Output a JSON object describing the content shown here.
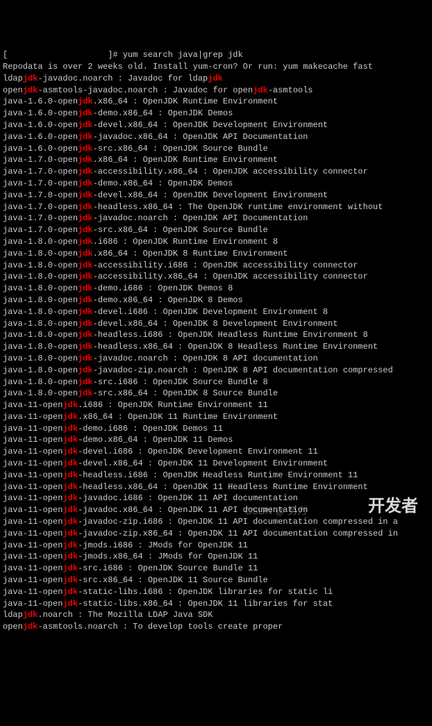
{
  "prompt_prefix": "[",
  "prompt_suffix": "]# ",
  "command": "yum search java|grep jdk",
  "repo_msg": "Repodata is over 2 weeks old. Install yum-cron? Or run: yum makecache fast",
  "lines": [
    {
      "pre": "ldap",
      "hl": "jdk",
      "mid": "-javadoc.noarch : Javadoc for ldap",
      "hl2": "jdk",
      "post": ""
    },
    {
      "pre": "open",
      "hl": "jdk",
      "mid": "-asmtools-javadoc.noarch : Javadoc for open",
      "hl2": "jdk",
      "post": "-asmtools"
    },
    {
      "pre": "java-1.6.0-open",
      "hl": "jdk",
      "mid": ".x86_64 : OpenJDK Runtime Environment",
      "hl2": "",
      "post": ""
    },
    {
      "pre": "java-1.6.0-open",
      "hl": "jdk",
      "mid": "-demo.x86_64 : OpenJDK Demos",
      "hl2": "",
      "post": ""
    },
    {
      "pre": "java-1.6.0-open",
      "hl": "jdk",
      "mid": "-devel.x86_64 : OpenJDK Development Environment",
      "hl2": "",
      "post": ""
    },
    {
      "pre": "java-1.6.0-open",
      "hl": "jdk",
      "mid": "-javadoc.x86_64 : OpenJDK API Documentation",
      "hl2": "",
      "post": ""
    },
    {
      "pre": "java-1.6.0-open",
      "hl": "jdk",
      "mid": "-src.x86_64 : OpenJDK Source Bundle",
      "hl2": "",
      "post": ""
    },
    {
      "pre": "java-1.7.0-open",
      "hl": "jdk",
      "mid": ".x86_64 : OpenJDK Runtime Environment",
      "hl2": "",
      "post": ""
    },
    {
      "pre": "java-1.7.0-open",
      "hl": "jdk",
      "mid": "-accessibility.x86_64 : OpenJDK accessibility connector",
      "hl2": "",
      "post": ""
    },
    {
      "pre": "java-1.7.0-open",
      "hl": "jdk",
      "mid": "-demo.x86_64 : OpenJDK Demos",
      "hl2": "",
      "post": ""
    },
    {
      "pre": "java-1.7.0-open",
      "hl": "jdk",
      "mid": "-devel.x86_64 : OpenJDK Development Environment",
      "hl2": "",
      "post": ""
    },
    {
      "pre": "java-1.7.0-open",
      "hl": "jdk",
      "mid": "-headless.x86_64 : The OpenJDK runtime environment without",
      "hl2": "",
      "post": ""
    },
    {
      "pre": "java-1.7.0-open",
      "hl": "jdk",
      "mid": "-javadoc.noarch : OpenJDK API Documentation",
      "hl2": "",
      "post": ""
    },
    {
      "pre": "java-1.7.0-open",
      "hl": "jdk",
      "mid": "-src.x86_64 : OpenJDK Source Bundle",
      "hl2": "",
      "post": ""
    },
    {
      "pre": "java-1.8.0-open",
      "hl": "jdk",
      "mid": ".i686 : OpenJDK Runtime Environment 8",
      "hl2": "",
      "post": ""
    },
    {
      "pre": "java-1.8.0-open",
      "hl": "jdk",
      "mid": ".x86_64 : OpenJDK 8 Runtime Environment",
      "hl2": "",
      "post": ""
    },
    {
      "pre": "java-1.8.0-open",
      "hl": "jdk",
      "mid": "-accessibility.i686 : OpenJDK accessibility connector",
      "hl2": "",
      "post": ""
    },
    {
      "pre": "java-1.8.0-open",
      "hl": "jdk",
      "mid": "-accessibility.x86_64 : OpenJDK accessibility connector",
      "hl2": "",
      "post": ""
    },
    {
      "pre": "java-1.8.0-open",
      "hl": "jdk",
      "mid": "-demo.i686 : OpenJDK Demos 8",
      "hl2": "",
      "post": ""
    },
    {
      "pre": "java-1.8.0-open",
      "hl": "jdk",
      "mid": "-demo.x86_64 : OpenJDK 8 Demos",
      "hl2": "",
      "post": ""
    },
    {
      "pre": "java-1.8.0-open",
      "hl": "jdk",
      "mid": "-devel.i686 : OpenJDK Development Environment 8",
      "hl2": "",
      "post": ""
    },
    {
      "pre": "java-1.8.0-open",
      "hl": "jdk",
      "mid": "-devel.x86_64 : OpenJDK 8 Development Environment",
      "hl2": "",
      "post": ""
    },
    {
      "pre": "java-1.8.0-open",
      "hl": "jdk",
      "mid": "-headless.i686 : OpenJDK Headless Runtime Environment 8",
      "hl2": "",
      "post": ""
    },
    {
      "pre": "java-1.8.0-open",
      "hl": "jdk",
      "mid": "-headless.x86_64 : OpenJDK 8 Headless Runtime Environment",
      "hl2": "",
      "post": ""
    },
    {
      "pre": "java-1.8.0-open",
      "hl": "jdk",
      "mid": "-javadoc.noarch : OpenJDK 8 API documentation",
      "hl2": "",
      "post": ""
    },
    {
      "pre": "java-1.8.0-open",
      "hl": "jdk",
      "mid": "-javadoc-zip.noarch : OpenJDK 8 API documentation compressed",
      "hl2": "",
      "post": ""
    },
    {
      "pre": "java-1.8.0-open",
      "hl": "jdk",
      "mid": "-src.i686 : OpenJDK Source Bundle 8",
      "hl2": "",
      "post": ""
    },
    {
      "pre": "java-1.8.0-open",
      "hl": "jdk",
      "mid": "-src.x86_64 : OpenJDK 8 Source Bundle",
      "hl2": "",
      "post": ""
    },
    {
      "pre": "java-11-open",
      "hl": "jdk",
      "mid": ".i686 : OpenJDK Runtime Environment 11",
      "hl2": "",
      "post": ""
    },
    {
      "pre": "java-11-open",
      "hl": "jdk",
      "mid": ".x86_64 : OpenJDK 11 Runtime Environment",
      "hl2": "",
      "post": ""
    },
    {
      "pre": "java-11-open",
      "hl": "jdk",
      "mid": "-demo.i686 : OpenJDK Demos 11",
      "hl2": "",
      "post": ""
    },
    {
      "pre": "java-11-open",
      "hl": "jdk",
      "mid": "-demo.x86_64 : OpenJDK 11 Demos",
      "hl2": "",
      "post": ""
    },
    {
      "pre": "java-11-open",
      "hl": "jdk",
      "mid": "-devel.i686 : OpenJDK Development Environment 11",
      "hl2": "",
      "post": ""
    },
    {
      "pre": "java-11-open",
      "hl": "jdk",
      "mid": "-devel.x86_64 : OpenJDK 11 Development Environment",
      "hl2": "",
      "post": ""
    },
    {
      "pre": "java-11-open",
      "hl": "jdk",
      "mid": "-headless.i686 : OpenJDK Headless Runtime Environment 11",
      "hl2": "",
      "post": ""
    },
    {
      "pre": "java-11-open",
      "hl": "jdk",
      "mid": "-headless.x86_64 : OpenJDK 11 Headless Runtime Environment",
      "hl2": "",
      "post": ""
    },
    {
      "pre": "java-11-open",
      "hl": "jdk",
      "mid": "-javadoc.i686 : OpenJDK 11 API documentation",
      "hl2": "",
      "post": ""
    },
    {
      "pre": "java-11-open",
      "hl": "jdk",
      "mid": "-javadoc.x86_64 : OpenJDK 11 API documentation",
      "hl2": "",
      "post": ""
    },
    {
      "pre": "java-11-open",
      "hl": "jdk",
      "mid": "-javadoc-zip.i686 : OpenJDK 11 API documentation compressed in a",
      "hl2": "",
      "post": ""
    },
    {
      "pre": "java-11-open",
      "hl": "jdk",
      "mid": "-javadoc-zip.x86_64 : OpenJDK 11 API documentation compressed in",
      "hl2": "",
      "post": ""
    },
    {
      "pre": "java-11-open",
      "hl": "jdk",
      "mid": "-jmods.i686 : JMods for OpenJDK 11",
      "hl2": "",
      "post": ""
    },
    {
      "pre": "java-11-open",
      "hl": "jdk",
      "mid": "-jmods.x86_64 : JMods for OpenJDK 11",
      "hl2": "",
      "post": ""
    },
    {
      "pre": "java-11-open",
      "hl": "jdk",
      "mid": "-src.i686 : OpenJDK Source Bundle 11",
      "hl2": "",
      "post": ""
    },
    {
      "pre": "java-11-open",
      "hl": "jdk",
      "mid": "-src.x86_64 : OpenJDK 11 Source Bundle",
      "hl2": "",
      "post": ""
    },
    {
      "pre": "java-11-open",
      "hl": "jdk",
      "mid": "-static-libs.i686 : OpenJDK libraries for static li",
      "hl2": "",
      "post": ""
    },
    {
      "pre": "java-11-open",
      "hl": "jdk",
      "mid": "-static-libs.x86_64 : OpenJDK 11 libraries for stat",
      "hl2": "",
      "post": ""
    },
    {
      "pre": "ldap",
      "hl": "jdk",
      "mid": ".noarch : The Mozilla LDAP Java SDK",
      "hl2": "",
      "post": ""
    },
    {
      "pre": "open",
      "hl": "jdk",
      "mid": "-asmtools.noarch : To develop tools create proper",
      "hl2": "",
      "post": ""
    }
  ],
  "watermark": "开发者",
  "watermark2": "CSDN @ 努力"
}
